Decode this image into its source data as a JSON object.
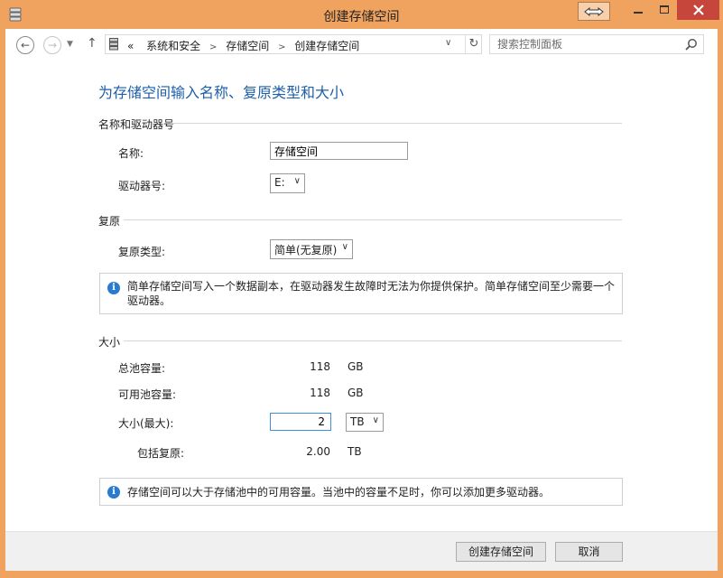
{
  "window": {
    "title": "创建存储空间",
    "controls": {
      "minimize": "—",
      "maximize": "☐",
      "close": "✕"
    }
  },
  "address": {
    "crumbs_prefix": "«",
    "crumbs": [
      "系统和安全",
      "存储空间",
      "创建存储空间"
    ],
    "search_placeholder": "搜索控制面板"
  },
  "page": {
    "heading": "为存储空间输入名称、复原类型和大小",
    "name_section": {
      "label": "名称和驱动器号",
      "name_label": "名称:",
      "name_value": "存储空间",
      "drive_label": "驱动器号:",
      "drive_value": "E:"
    },
    "resiliency_section": {
      "label": "复原",
      "type_label": "复原类型:",
      "type_value": "简单(无复原)",
      "info_line1": "简单存储空间写入一个数据副本，在驱动器发生故障时无法为你提供保护。简单存储空间至少需要一个",
      "info_line2": "驱动器。"
    },
    "size_section": {
      "label": "大小",
      "total_label": "总池容量:",
      "total_value": "118",
      "total_unit": "GB",
      "avail_label": "可用池容量:",
      "avail_value": "118",
      "avail_unit": "GB",
      "size_label": "大小(最大):",
      "size_value": "2",
      "size_unit": "TB",
      "incl_label": "包括复原:",
      "incl_value": "2.00",
      "incl_unit": "TB",
      "info": "存储空间可以大于存储池中的可用容量。当池中的容量不足时，你可以添加更多驱动器。"
    }
  },
  "footer": {
    "create_label": "创建存储空间",
    "cancel_label": "取消"
  },
  "colors": {
    "accent": "#1e5fa8",
    "frame": "#f0a35e",
    "close": "#c7463c",
    "info": "#2a7ad0"
  }
}
